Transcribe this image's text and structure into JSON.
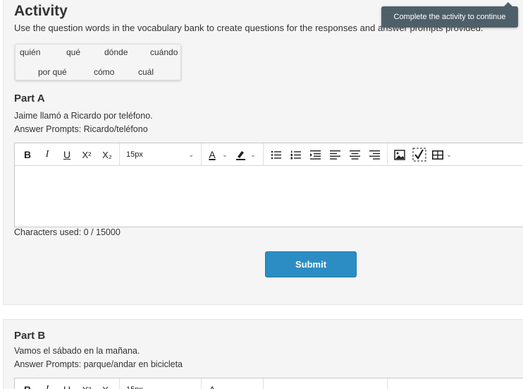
{
  "activity": {
    "title": "Activity",
    "instructions": "Use the question words in the vocabulary bank to create questions for the responses and answer prompts provided.",
    "vocab_bank": [
      "quién",
      "qué",
      "dónde",
      "cuándo",
      "por qué",
      "cómo",
      "cuál"
    ]
  },
  "tooltip": {
    "text": "Complete the activity to continue"
  },
  "part_a": {
    "title": "Part A",
    "sentence": "Jaime llamó a Ricardo por teléfono.",
    "prompts": "Answer Prompts: Ricardo/teléfono",
    "counter": "Characters used: 0 / 15000",
    "submit_label": "Submit"
  },
  "part_b": {
    "title": "Part B",
    "sentence": "Vamos el sábado en la mañana.",
    "prompts": "Answer Prompts: parque/andar en bicicleta"
  },
  "toolbar": {
    "bold": "B",
    "italic": "I",
    "underline": "U",
    "superscript": "X²",
    "subscript": "X₂",
    "font_size": "15px",
    "text_color": "A"
  },
  "colors": {
    "accent": "#2c8dc4",
    "tooltip": "#4f5f6a",
    "card": "#f5f5f5"
  }
}
